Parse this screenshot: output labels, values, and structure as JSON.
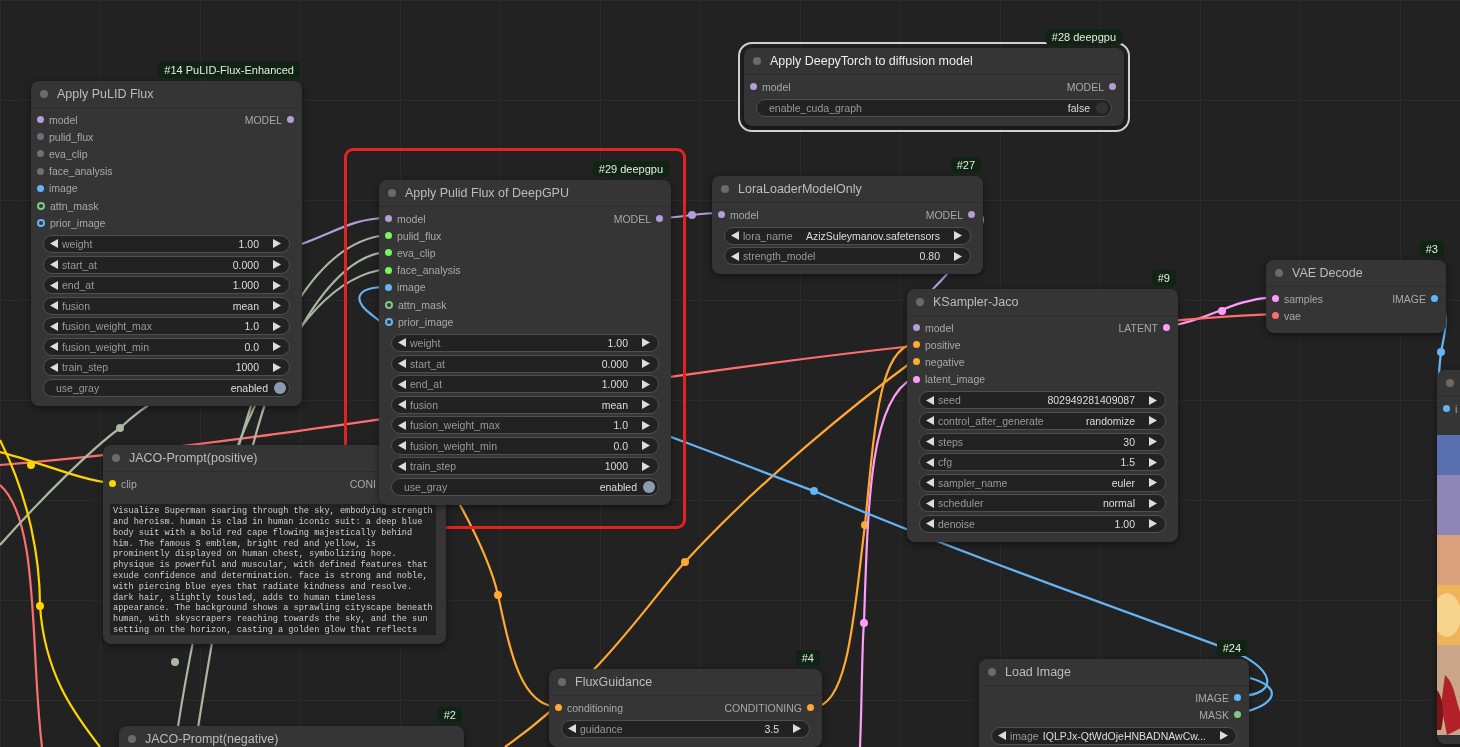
{
  "nodes": [
    {
      "badge": "#28 deepgpu",
      "title": "Apply DeepyTorch to diffusion model",
      "selected": true,
      "highlighted": false,
      "inputs": [
        {
          "label": "model",
          "color": "#b39ddb",
          "optional": false
        }
      ],
      "outputs": [
        {
          "label": "MODEL",
          "color": "#b39ddb"
        }
      ],
      "widgets": [
        {
          "kind": "toggle",
          "label": "enable_cuda_graph",
          "value": "false",
          "on": false
        }
      ]
    },
    {
      "badge": "#14 PuLID-Flux-Enhanced",
      "title": "Apply PuLID Flux",
      "selected": false,
      "highlighted": false,
      "inputs": [
        {
          "label": "model",
          "color": "#b39ddb",
          "optional": false
        },
        {
          "label": "pulid_flux",
          "color": "#6f6f78",
          "optional": false
        },
        {
          "label": "eva_clip",
          "color": "#6f6f78",
          "optional": false
        },
        {
          "label": "face_analysis",
          "color": "#6f6f78",
          "optional": false
        },
        {
          "label": "image",
          "color": "#64b5f6",
          "optional": false
        },
        {
          "label": "attn_mask",
          "color": "#81c784",
          "optional": true
        },
        {
          "label": "prior_image",
          "color": "#64b5f6",
          "optional": true
        }
      ],
      "outputs": [
        {
          "label": "MODEL",
          "color": "#b39ddb"
        }
      ],
      "widgets": [
        {
          "kind": "number",
          "label": "weight",
          "value": "1.00"
        },
        {
          "kind": "number",
          "label": "start_at",
          "value": "0.000"
        },
        {
          "kind": "number",
          "label": "end_at",
          "value": "1.000"
        },
        {
          "kind": "number",
          "label": "fusion",
          "value": "mean"
        },
        {
          "kind": "number",
          "label": "fusion_weight_max",
          "value": "1.0"
        },
        {
          "kind": "number",
          "label": "fusion_weight_min",
          "value": "0.0"
        },
        {
          "kind": "number",
          "label": "train_step",
          "value": "1000"
        },
        {
          "kind": "toggle",
          "label": "use_gray",
          "value": "enabled",
          "on": true
        }
      ]
    },
    {
      "badge": "#29 deepgpu",
      "title": "Apply Pulid Flux of DeepGPU",
      "selected": false,
      "highlighted": true,
      "inputs": [
        {
          "label": "model",
          "color": "#b39ddb",
          "optional": false
        },
        {
          "label": "pulid_flux",
          "color": "#7cf25c",
          "optional": false
        },
        {
          "label": "eva_clip",
          "color": "#7cf25c",
          "optional": false
        },
        {
          "label": "face_analysis",
          "color": "#7cf25c",
          "optional": false
        },
        {
          "label": "image",
          "color": "#64b5f6",
          "optional": false
        },
        {
          "label": "attn_mask",
          "color": "#81c784",
          "optional": true
        },
        {
          "label": "prior_image",
          "color": "#64b5f6",
          "optional": true
        }
      ],
      "outputs": [
        {
          "label": "MODEL",
          "color": "#b39ddb"
        }
      ],
      "widgets": [
        {
          "kind": "number",
          "label": "weight",
          "value": "1.00"
        },
        {
          "kind": "number",
          "label": "start_at",
          "value": "0.000"
        },
        {
          "kind": "number",
          "label": "end_at",
          "value": "1.000"
        },
        {
          "kind": "number",
          "label": "fusion",
          "value": "mean"
        },
        {
          "kind": "number",
          "label": "fusion_weight_max",
          "value": "1.0"
        },
        {
          "kind": "number",
          "label": "fusion_weight_min",
          "value": "0.0"
        },
        {
          "kind": "number",
          "label": "train_step",
          "value": "1000"
        },
        {
          "kind": "toggle",
          "label": "use_gray",
          "value": "enabled",
          "on": true
        }
      ]
    },
    {
      "badge": "#27",
      "title": "LoraLoaderModelOnly",
      "selected": false,
      "highlighted": false,
      "inputs": [
        {
          "label": "model",
          "color": "#b39ddb",
          "optional": false
        }
      ],
      "outputs": [
        {
          "label": "MODEL",
          "color": "#b39ddb"
        }
      ],
      "widgets": [
        {
          "kind": "number",
          "label": "lora_name",
          "value": "AzizSuleymanov.safetensors"
        },
        {
          "kind": "number",
          "label": "strength_model",
          "value": "0.80"
        }
      ]
    },
    {
      "badge": "#3",
      "title": "VAE Decode",
      "selected": false,
      "highlighted": false,
      "inputs": [
        {
          "label": "samples",
          "color": "#ff9cf9",
          "optional": false
        },
        {
          "label": "vae",
          "color": "#ff6e6e",
          "optional": false
        }
      ],
      "outputs": [
        {
          "label": "IMAGE",
          "color": "#64b5f6"
        }
      ]
    },
    {
      "badge": "#9",
      "title": "KSampler-Jaco",
      "selected": false,
      "highlighted": false,
      "inputs": [
        {
          "label": "model",
          "color": "#b39ddb",
          "optional": false
        },
        {
          "label": "positive",
          "color": "#ffa931",
          "optional": false
        },
        {
          "label": "negative",
          "color": "#ffa931",
          "optional": false
        },
        {
          "label": "latent_image",
          "color": "#ff9cf9",
          "optional": false
        }
      ],
      "outputs": [
        {
          "label": "LATENT",
          "color": "#ff9cf9"
        }
      ],
      "widgets": [
        {
          "kind": "number",
          "label": "seed",
          "value": "802949281409087"
        },
        {
          "kind": "number",
          "label": "control_after_generate",
          "value": "randomize"
        },
        {
          "kind": "number",
          "label": "steps",
          "value": "30"
        },
        {
          "kind": "number",
          "label": "cfg",
          "value": "1.5"
        },
        {
          "kind": "number",
          "label": "sampler_name",
          "value": "euler"
        },
        {
          "kind": "number",
          "label": "scheduler",
          "value": "normal"
        },
        {
          "kind": "number",
          "label": "denoise",
          "value": "1.00"
        }
      ]
    },
    {
      "inputs": [
        {
          "label": "i",
          "color": "#64b5f6",
          "optional": false
        }
      ],
      "preview": {
        "kind": "picture"
      }
    },
    {
      "title": "JACO-Prompt(positive)",
      "selected": false,
      "highlighted": false,
      "inputs": [
        {
          "label": "clip",
          "color": "#ffd500",
          "optional": false
        }
      ],
      "outputs": [
        {
          "label": "CONI"
        }
      ],
      "prompt": "Visualize Superman soaring through the sky, embodying strength and heroism. human is clad in human iconic suit: a deep blue body suit with a bold red cape flowing majestically behind him. The famous S emblem, bright red and yellow, is prominently displayed on human chest, symbolizing hope. physique is powerful and muscular, with defined features that exude confidence and determination. face is strong and noble, with piercing blue eyes that radiate kindness and resolve. dark hair, slightly tousled, adds to human timeless appearance. The background shows a sprawling cityscape beneath human, with skyscrapers reaching towards the sky, and the sun setting on the horizon, casting a golden glow that reflects"
    },
    {
      "badge": "#2",
      "title": "JACO-Prompt(negative)",
      "selected": false,
      "highlighted": false
    },
    {
      "badge": "#4",
      "title": "FluxGuidance",
      "selected": false,
      "highlighted": false,
      "inputs": [
        {
          "label": "conditioning",
          "color": "#ffa931",
          "optional": false
        }
      ],
      "outputs": [
        {
          "label": "CONDITIONING",
          "color": "#ffa931"
        }
      ],
      "widgets": [
        {
          "kind": "number",
          "label": "guidance",
          "value": "3.5"
        }
      ]
    },
    {
      "badge": "#24",
      "title": "Load Image",
      "selected": false,
      "highlighted": false,
      "outputs": [
        {
          "label": "IMAGE",
          "color": "#64b5f6"
        },
        {
          "label": "MASK",
          "color": "#81c784"
        }
      ],
      "widgets": [
        {
          "kind": "number",
          "label": "image",
          "value": "IQLPJx-QtWdOjeHNBADNAwCw..."
        }
      ]
    }
  ]
}
